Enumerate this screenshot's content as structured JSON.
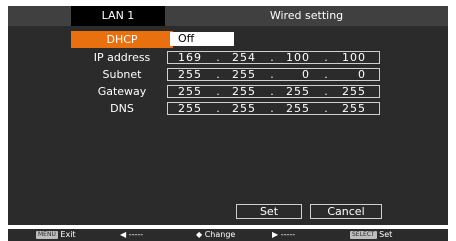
{
  "header": {
    "left_title": "LAN 1",
    "right_title": "Wired setting"
  },
  "rows": [
    {
      "label": "DHCP",
      "value": "Off"
    },
    {
      "label": "IP address",
      "octets": [
        "169",
        "254",
        "100",
        "100"
      ]
    },
    {
      "label": "Subnet",
      "octets": [
        "255",
        "255",
        "0",
        "0"
      ]
    },
    {
      "label": "Gateway",
      "octets": [
        "255",
        "255",
        "255",
        "255"
      ]
    },
    {
      "label": "DNS",
      "octets": [
        "255",
        "255",
        "255",
        "255"
      ]
    }
  ],
  "buttons": {
    "set": "Set",
    "cancel": "Cancel"
  },
  "footer": {
    "menu_key": "MENU",
    "exit": "Exit",
    "left": "◀ -----",
    "change": "◆ Change",
    "right": "▶ -----",
    "select_key": "SELECT",
    "set": "Set"
  },
  "colors": {
    "accent": "#e8700e",
    "panel": "#2b2b2b",
    "header": "#404040"
  }
}
